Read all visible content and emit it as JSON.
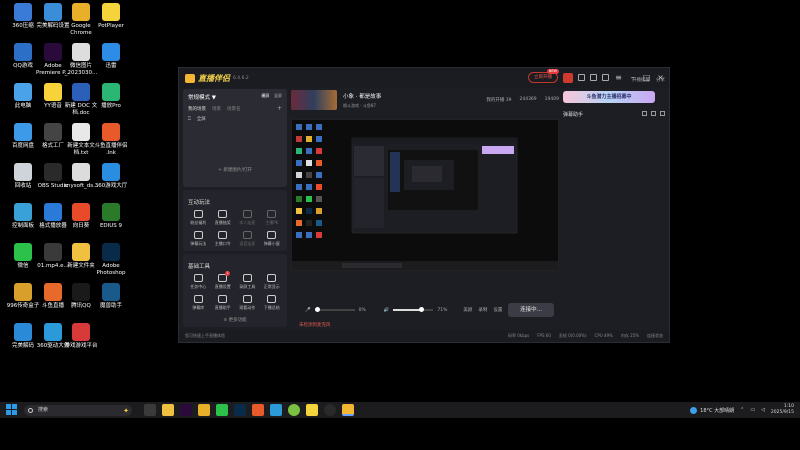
{
  "desktop_icons": [
    {
      "label": "360压缩",
      "color": "#3b7bd8"
    },
    {
      "label": "完美解码设置",
      "color": "#3a8ed8"
    },
    {
      "label": "Google\nChrome",
      "color": "#e8b02a"
    },
    {
      "label": "PotPlayer",
      "color": "#f5d33b"
    },
    {
      "label": "QQ游戏",
      "color": "#2c6fc7"
    },
    {
      "label": "Adobe\nPremiere P...",
      "color": "#2a0a3a"
    },
    {
      "label": "微信图片\n_2023030...",
      "color": "#dddddd"
    },
    {
      "label": "迅雷",
      "color": "#2c8ce6"
    },
    {
      "label": "此电脑",
      "color": "#4aa3e8"
    },
    {
      "label": "YY语音",
      "color": "#f7d23b"
    },
    {
      "label": "新建 DOC 文\n档.doc",
      "color": "#2b5fb8"
    },
    {
      "label": "播放Pro",
      "color": "#2bb673"
    },
    {
      "label": "百度网盘",
      "color": "#3d9ae8"
    },
    {
      "label": "格式工厂",
      "color": "#444444"
    },
    {
      "label": "新建文本文\n档.txt",
      "color": "#e8e8e8"
    },
    {
      "label": "斗鱼直播伴侣\n.lnk",
      "color": "#e85a2a"
    },
    {
      "label": "回收站",
      "color": "#cfd4da"
    },
    {
      "label": "OBS Studio",
      "color": "#2a2a2a"
    },
    {
      "label": "anysoft_ds...",
      "color": "#dcdcdc"
    },
    {
      "label": "360游戏大厅",
      "color": "#2a8de0"
    },
    {
      "label": "控制面板",
      "color": "#3aa0d8"
    },
    {
      "label": "格式播放器",
      "color": "#2a7ad8"
    },
    {
      "label": "向日葵",
      "color": "#e84a2a"
    },
    {
      "label": "EDIUS 9",
      "color": "#2a7a2a"
    },
    {
      "label": "微信",
      "color": "#2bc14a"
    },
    {
      "label": "01.mp4.e...",
      "color": "#3a3a3a"
    },
    {
      "label": "新建文件夹",
      "color": "#f0c040"
    },
    {
      "label": "Adobe\nPhotoshop",
      "color": "#0a2a4a"
    },
    {
      "label": "996传奇盒子",
      "color": "#d8a02a"
    },
    {
      "label": "斗鱼直播",
      "color": "#e86a2a"
    },
    {
      "label": "腾讯QQ",
      "color": "#1a1a1a"
    },
    {
      "label": "魔兽助手",
      "color": "#1a5a8a"
    },
    {
      "label": "完美解码",
      "color": "#2a8ad8"
    },
    {
      "label": "360驱动大师",
      "color": "#2a9ad8"
    },
    {
      "label": "游戏游戏平台",
      "color": "#d83a3a"
    }
  ],
  "app": {
    "name": "直播伴侣",
    "version": "6.4.6.2",
    "live_btn": "立即开播",
    "live_badge": "NEW",
    "scene": {
      "mode": "常规模式 ▼",
      "tab_landscape": "横屏",
      "tab_portrait": "竖屏",
      "tabs": [
        "我的场景",
        "场景",
        "场景名"
      ],
      "source": "全屏",
      "add_source": "+ 新建图片/打开",
      "plus": "+"
    },
    "interact": {
      "title": "互动玩法",
      "items": [
        {
          "label": "粉丝福利",
          "dim": false
        },
        {
          "label": "直播抽奖",
          "dim": false
        },
        {
          "label": "本人连麦",
          "dim": true
        },
        {
          "label": "主播PK",
          "dim": true
        },
        {
          "label": "弹幕玩法",
          "dim": false
        },
        {
          "label": "主播口令",
          "dim": false
        },
        {
          "label": "语音连麦",
          "dim": true
        },
        {
          "label": "弹幕小窗",
          "dim": false
        }
      ]
    },
    "tools": {
      "title": "基础工具",
      "items": [
        {
          "label": "任务中心",
          "badge": ""
        },
        {
          "label": "直播设置",
          "badge": "1"
        },
        {
          "label": "录屏工具",
          "badge": ""
        },
        {
          "label": "正常显示",
          "badge": ""
        },
        {
          "label": "弹幕库",
          "badge": ""
        },
        {
          "label": "直播助手",
          "badge": ""
        },
        {
          "label": "观看动作",
          "badge": ""
        },
        {
          "label": "下播总结",
          "badge": ""
        }
      ],
      "more": "≡ 更多功能"
    },
    "stream": {
      "title": "小象 · 都是故事",
      "meta": "格斗游戏 · 斗鱼87",
      "stats": [
        "我的开播 39",
        "244369",
        "19409"
      ]
    },
    "audio": {
      "mic_value": "0%",
      "speaker_label": "扬声器",
      "speaker_value": "71%",
      "buttons": [
        "美颜",
        "录制",
        "设置"
      ],
      "start_button": "连接中..."
    },
    "warning": "未检测到麦克风",
    "right": {
      "share": "分享",
      "open_live": "开播提醒",
      "banner": "斗鱼潜力主播招募中",
      "danmu_title": "弹幕助手"
    },
    "statusbar": {
      "left": "您可快速上手直播体验",
      "right": [
        "码率 0kbps",
        "FPS 60",
        "丢帧 0(0.00%)",
        "CPU 49%",
        "内存 25%",
        "连接状态"
      ]
    }
  },
  "taskbar": {
    "search_placeholder": "搜索",
    "weather": "18°C  大部晴朗",
    "time": "1:10",
    "date": "2025/9/15"
  }
}
